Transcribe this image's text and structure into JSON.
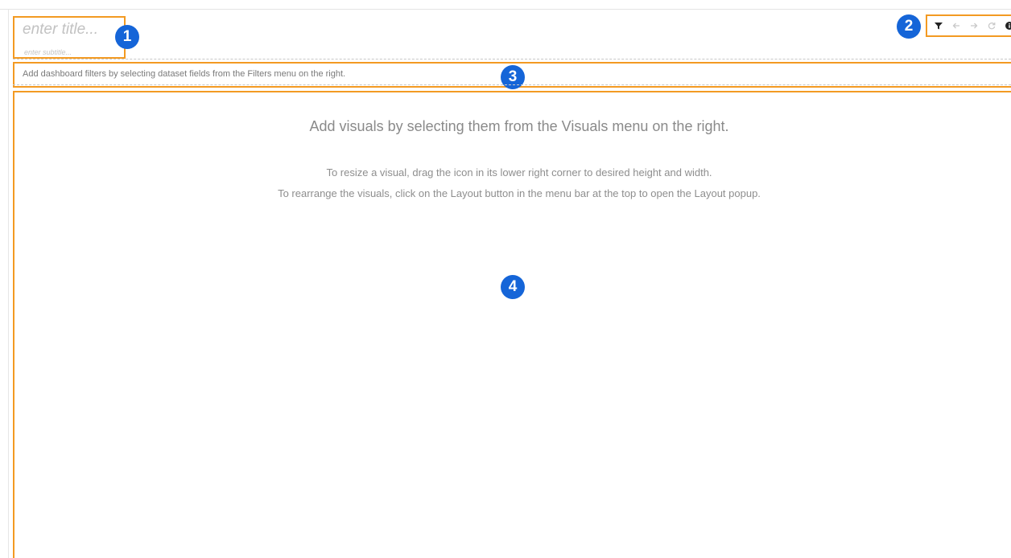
{
  "header": {
    "title_placeholder": "enter title...",
    "subtitle_placeholder": "enter subtitle..."
  },
  "toolbar": {
    "icons": [
      "filter-icon",
      "back-arrow-icon",
      "forward-arrow-icon",
      "refresh-icon",
      "info-icon"
    ]
  },
  "filters_bar": {
    "hint": "Add dashboard filters by selecting dataset fields from the Filters menu on the right."
  },
  "visuals_area": {
    "heading": "Add visuals by selecting them from the Visuals menu on the right.",
    "line1": "To resize a visual, drag the icon in its lower right corner to desired height and width.",
    "line2": "To rearrange the visuals, click on the Layout button in the menu bar at the top to open the Layout popup."
  },
  "markers": [
    "1",
    "2",
    "3",
    "4"
  ],
  "colors": {
    "highlight_border": "#f39a22",
    "marker_fill": "#1565d8"
  }
}
